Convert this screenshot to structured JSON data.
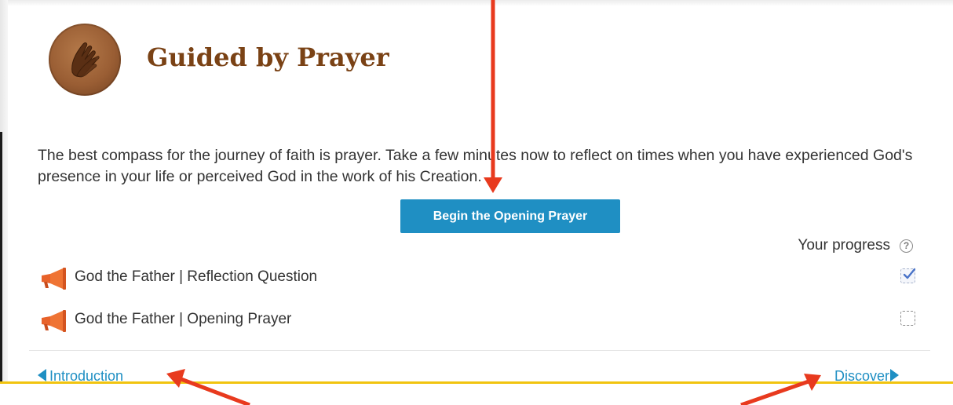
{
  "lesson": {
    "title": "Guided by Prayer",
    "icon": "praying-hands-icon",
    "intro": "The best compass for the journey of faith is prayer. Take a few minutes now to reflect on times when you have experienced God's presence in your life or perceived God in the work of his Creation.",
    "button_label": "Begin the Opening Prayer"
  },
  "progress": {
    "label": "Your progress",
    "help_icon": "question-circle-icon",
    "help_glyph": "?"
  },
  "items": [
    {
      "icon": "megaphone-icon",
      "label": "God the Father | Reflection Question",
      "completed": true
    },
    {
      "icon": "megaphone-icon",
      "label": "God the Father | Opening Prayer",
      "completed": false
    }
  ],
  "nav": {
    "prev_label": "Introduction",
    "next_label": "Discover"
  },
  "colors": {
    "title": "#7a4215",
    "accent_blue": "#1f8fc3",
    "megaphone": "#e8622a",
    "annotation_arrow": "#e83a1e",
    "bottom_bar": "#f1c40f"
  }
}
